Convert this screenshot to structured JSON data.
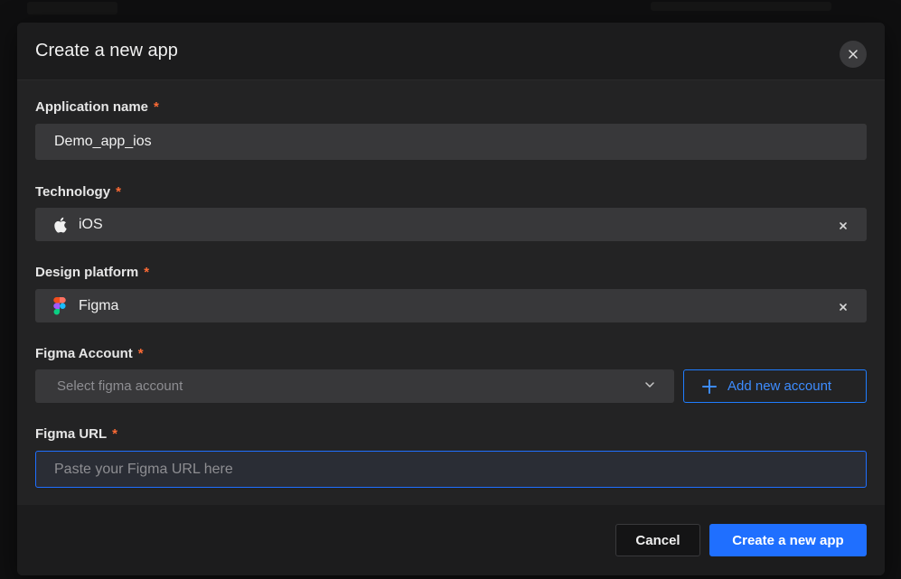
{
  "modal": {
    "title": "Create a new app"
  },
  "fields": {
    "application_name": {
      "label": "Application name",
      "required_mark": "*",
      "value": "Demo_app_ios"
    },
    "technology": {
      "label": "Technology",
      "required_mark": "*",
      "value": "iOS",
      "icon": "apple-icon"
    },
    "design_platform": {
      "label": "Design platform",
      "required_mark": "*",
      "value": "Figma",
      "icon": "figma-icon"
    },
    "figma_account": {
      "label": "Figma Account",
      "required_mark": "*",
      "placeholder": "Select figma account",
      "add_button_label": "Add new account"
    },
    "figma_url": {
      "label": "Figma URL",
      "required_mark": "*",
      "placeholder": "Paste your Figma URL here",
      "value": ""
    }
  },
  "footer": {
    "cancel_label": "Cancel",
    "create_label": "Create a new app"
  },
  "colors": {
    "accent": "#1f6fff",
    "required": "#ff6b35",
    "modal_bg": "#232324",
    "input_bg": "#38383a"
  }
}
